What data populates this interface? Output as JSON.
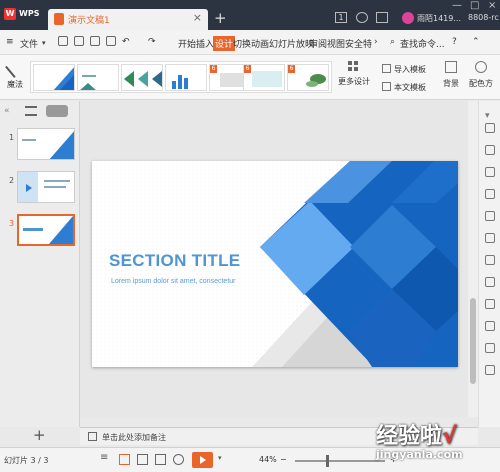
{
  "titlebar": {
    "app_name": "WPS",
    "doc_tab": "演示文稿1",
    "doc_close": "×",
    "add_tab": "+",
    "badge_count": "1",
    "user_name": "雨陌1419...",
    "user_id": "8808-rc"
  },
  "menu": {
    "file": "文件",
    "start": "开始",
    "insert": "插入",
    "design": "设计",
    "transition": "切换",
    "animation": "动画",
    "slideshow": "幻灯片放映",
    "review": "审阅",
    "view": "视图",
    "security": "安全",
    "special": "特",
    "search": "查找命令...",
    "help": "?"
  },
  "ribbon": {
    "magic": "魔法",
    "more_designs": "更多设计",
    "import_template": "导入模板",
    "this_template": "本文模板",
    "background": "背景",
    "color_scheme": "配色方",
    "theme_badges": [
      "6",
      "6",
      "6"
    ]
  },
  "slides": {
    "numbers": [
      "1",
      "2",
      "3"
    ],
    "selected_index": 3
  },
  "slide": {
    "title": "SECTION TITLE",
    "subtitle": "Lorem ipsum dolor sit amet, consectetur"
  },
  "notes": {
    "placeholder": "单击此处添加备注"
  },
  "status": {
    "slide_count": "幻灯片 3 / 3",
    "zoom": "44%",
    "zoom_minus": "−",
    "zoom_plus": "+"
  },
  "colors": {
    "accent": "#e8662c",
    "titlebar": "#2b3440",
    "slide_blue": "#1565c0",
    "title_blue": "#4f95d6"
  },
  "watermark": {
    "brand": "经验啦",
    "check": "√",
    "url": "jingyanla.com"
  }
}
